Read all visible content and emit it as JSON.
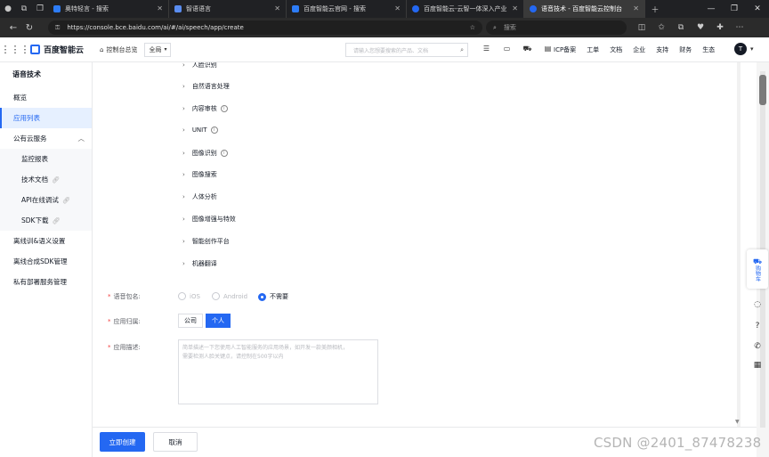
{
  "browser": {
    "tabs": [
      {
        "label": "奥特轻言 - 搜索",
        "color": "#2d7cf6"
      },
      {
        "label": "智语语言",
        "color": "#5a8df0"
      },
      {
        "label": "百度智能云官网 - 搜索",
        "color": "#2d7cf6"
      },
      {
        "label": "百度智能云-云智一体深入产业",
        "color": "#2468f2"
      },
      {
        "label": "语音技术 - 百度智能云控制台",
        "color": "#2468f2"
      }
    ],
    "url": "https://console.bce.baidu.com/ai/#/ai/speech/app/create",
    "search_placeholder": "搜索"
  },
  "header": {
    "logo": "百度智能云",
    "console_label": "控制台总览",
    "region": "全局",
    "search_placeholder": "请输入您想要搜索的产品、文档",
    "links": [
      "ICP备案",
      "工单",
      "文档",
      "企业",
      "支持",
      "财务",
      "生态"
    ],
    "avatar_letter": "T"
  },
  "sidebar": {
    "title": "语音技术",
    "items": [
      {
        "label": "概览"
      },
      {
        "label": "应用列表"
      },
      {
        "label": "公有云服务"
      },
      {
        "label": "监控报表"
      },
      {
        "label": "技术文档"
      },
      {
        "label": "API在线调试"
      },
      {
        "label": "SDK下载"
      },
      {
        "label": "离线训&语义设置"
      },
      {
        "label": "离线合成SDK管理"
      },
      {
        "label": "私有部署服务管理"
      }
    ]
  },
  "main": {
    "tree_items": [
      "人脸识别",
      "自然语言处理",
      "内容审核",
      "UNIT",
      "图像识别",
      "图像搜索",
      "人体分析",
      "图像增强与特效",
      "智能创作平台",
      "机器翻译"
    ],
    "package_label": "语音包名:",
    "package_options": [
      "iOS",
      "Android",
      "不需要"
    ],
    "package_selected": "不需要",
    "owner_label": "应用归属:",
    "owner_options": [
      "公司",
      "个人"
    ],
    "owner_selected": "个人",
    "desc_label": "应用描述:",
    "desc_placeholder_1": "简单描述一下您使用人工智能服务的应用场景，如开发一款美颜相机，",
    "desc_placeholder_2": "需要检测人脸关键点，请控制在500字以内"
  },
  "footer": {
    "create_button": "立即创建",
    "cancel_button": "取消"
  },
  "float": {
    "cart_label": "购物车"
  },
  "watermark": "CSDN @2401_87478238"
}
